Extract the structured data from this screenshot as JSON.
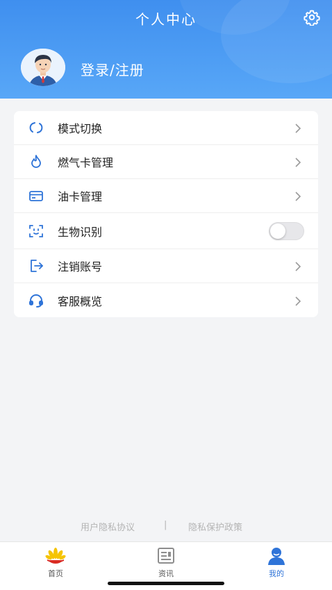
{
  "header": {
    "title": "个人中心",
    "login_label": "登录/注册"
  },
  "menu": {
    "items": [
      {
        "label": "模式切换",
        "icon": "swap-cycle-icon",
        "trailing": "chevron"
      },
      {
        "label": "燃气卡管理",
        "icon": "flame-icon",
        "trailing": "chevron"
      },
      {
        "label": "油卡管理",
        "icon": "card-icon",
        "trailing": "chevron"
      },
      {
        "label": "生物识别",
        "icon": "face-scan-icon",
        "trailing": "toggle",
        "toggle_on": false
      },
      {
        "label": "注销账号",
        "icon": "logout-icon",
        "trailing": "chevron"
      },
      {
        "label": "客服概览",
        "icon": "headset-icon",
        "trailing": "chevron"
      }
    ]
  },
  "footer": {
    "user_agreement": "用户隐私协议",
    "separator": "|",
    "privacy_policy": "隐私保护政策"
  },
  "tabbar": {
    "tabs": [
      {
        "label": "首页",
        "icon": "petrochina-logo-icon",
        "active": false
      },
      {
        "label": "资讯",
        "icon": "news-icon",
        "active": false
      },
      {
        "label": "我的",
        "icon": "profile-icon",
        "active": true
      }
    ]
  },
  "colors": {
    "header_gradient_top": "#3f8fef",
    "header_gradient_bottom": "#58a7f7",
    "icon_blue": "#2f74d8",
    "background": "#f3f4f6"
  }
}
